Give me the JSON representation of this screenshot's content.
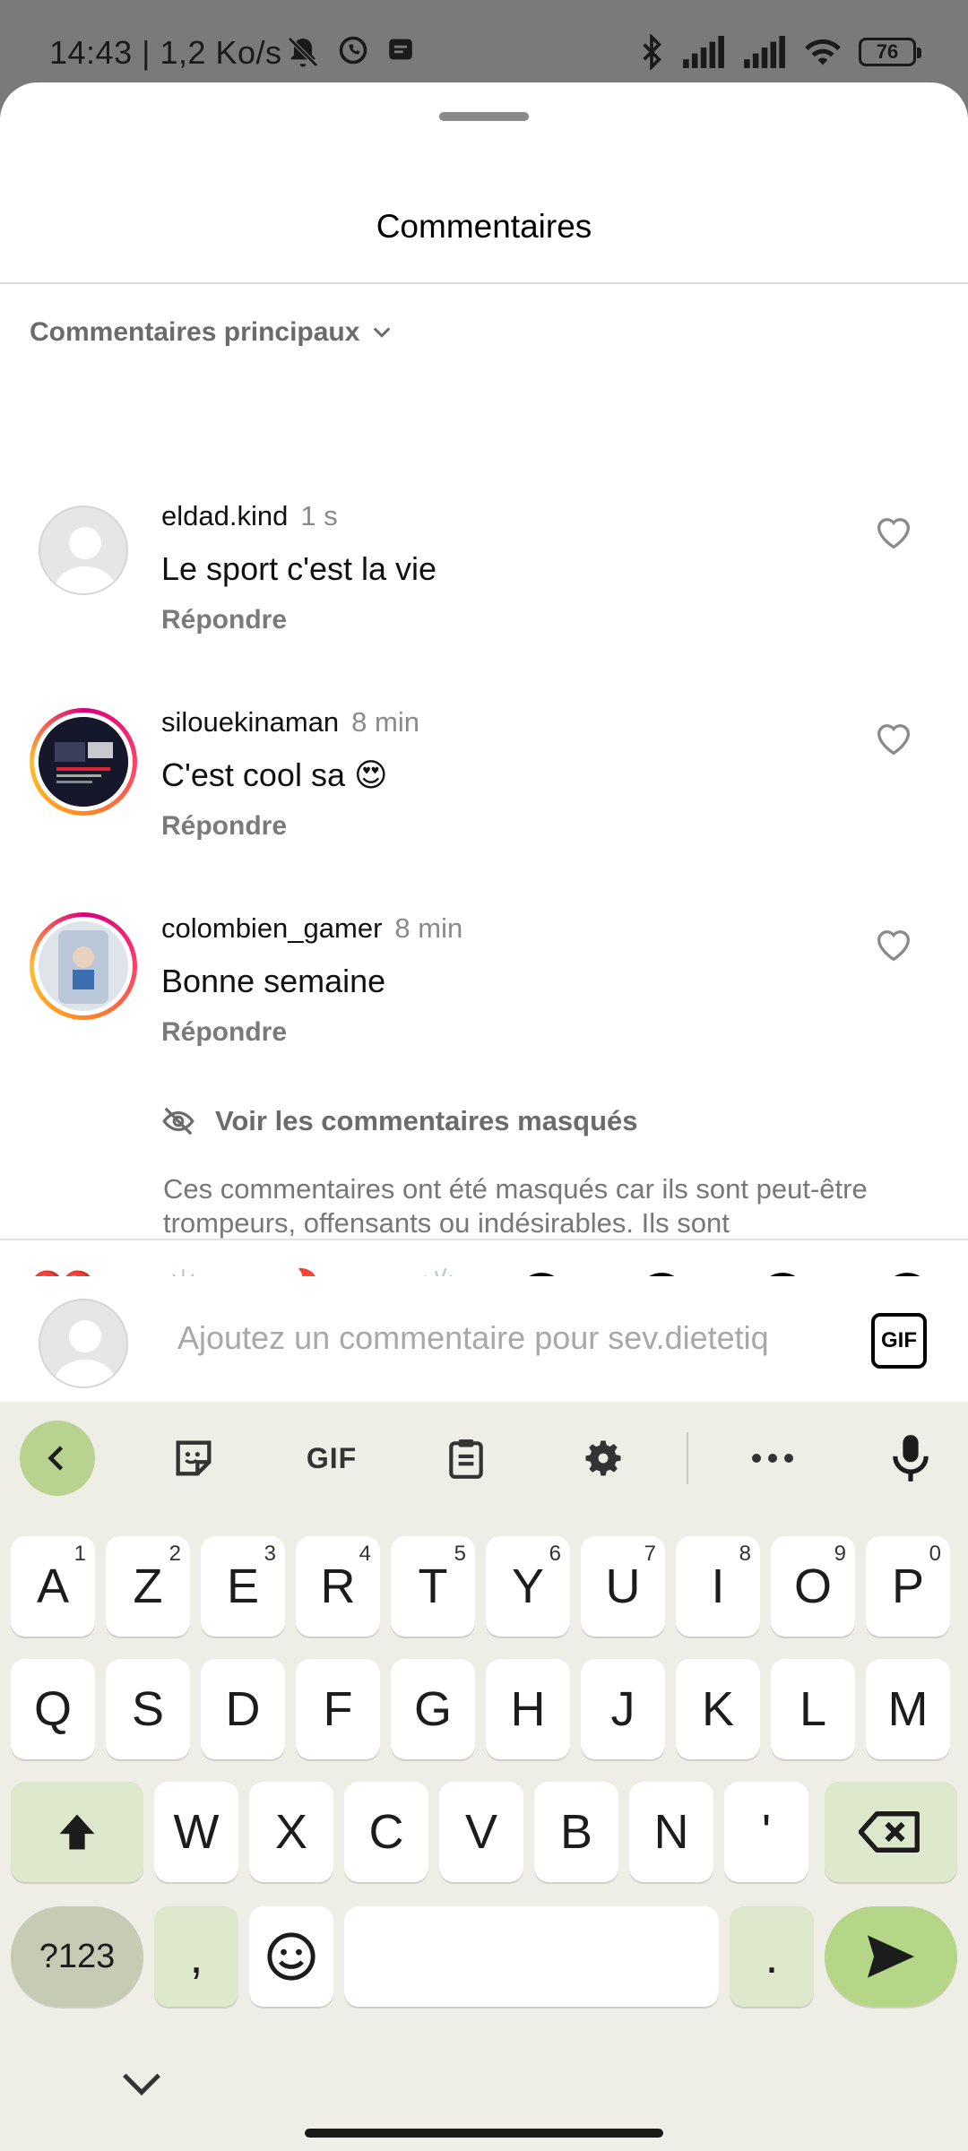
{
  "status_bar": {
    "time_speed": "14:43 | 1,2 Ko/s",
    "battery": "76"
  },
  "sheet": {
    "title": "Commentaires",
    "sort_label": "Commentaires principaux"
  },
  "comments": [
    {
      "username": "eldad.kind",
      "time": "1 s",
      "text": "Le sport c'est la vie",
      "reply": "Répondre",
      "avatar": "default"
    },
    {
      "username": "silouekinaman",
      "time": "8 min",
      "text": "C'est cool sa 😍",
      "reply": "Répondre",
      "avatar": "story"
    },
    {
      "username": "colombien_gamer",
      "time": "8 min",
      "text": "Bonne semaine",
      "reply": "Répondre",
      "avatar": "story"
    }
  ],
  "hidden": {
    "label": "Voir les commentaires masqués",
    "description": "Ces commentaires ont été masqués car ils sont peut-être trompeurs, offensants ou indésirables. Ils sont"
  },
  "reactions": [
    "❤️",
    "🙌",
    "🔥",
    "👏",
    "😢",
    "😍",
    "😮",
    "😂"
  ],
  "composer": {
    "placeholder": "Ajoutez un commentaire pour sev.dietetiq",
    "gif_label": "GIF"
  },
  "keyboard": {
    "toolbar_gif": "GIF",
    "row1": [
      {
        "k": "A",
        "s": "1"
      },
      {
        "k": "Z",
        "s": "2"
      },
      {
        "k": "E",
        "s": "3"
      },
      {
        "k": "R",
        "s": "4"
      },
      {
        "k": "T",
        "s": "5"
      },
      {
        "k": "Y",
        "s": "6"
      },
      {
        "k": "U",
        "s": "7"
      },
      {
        "k": "I",
        "s": "8"
      },
      {
        "k": "O",
        "s": "9"
      },
      {
        "k": "P",
        "s": "0"
      }
    ],
    "row2": [
      "Q",
      "S",
      "D",
      "F",
      "G",
      "H",
      "J",
      "K",
      "L",
      "M"
    ],
    "row3": [
      "W",
      "X",
      "C",
      "V",
      "B",
      "N",
      "'"
    ],
    "sym_label": "?123",
    "comma": ",",
    "period": "."
  }
}
